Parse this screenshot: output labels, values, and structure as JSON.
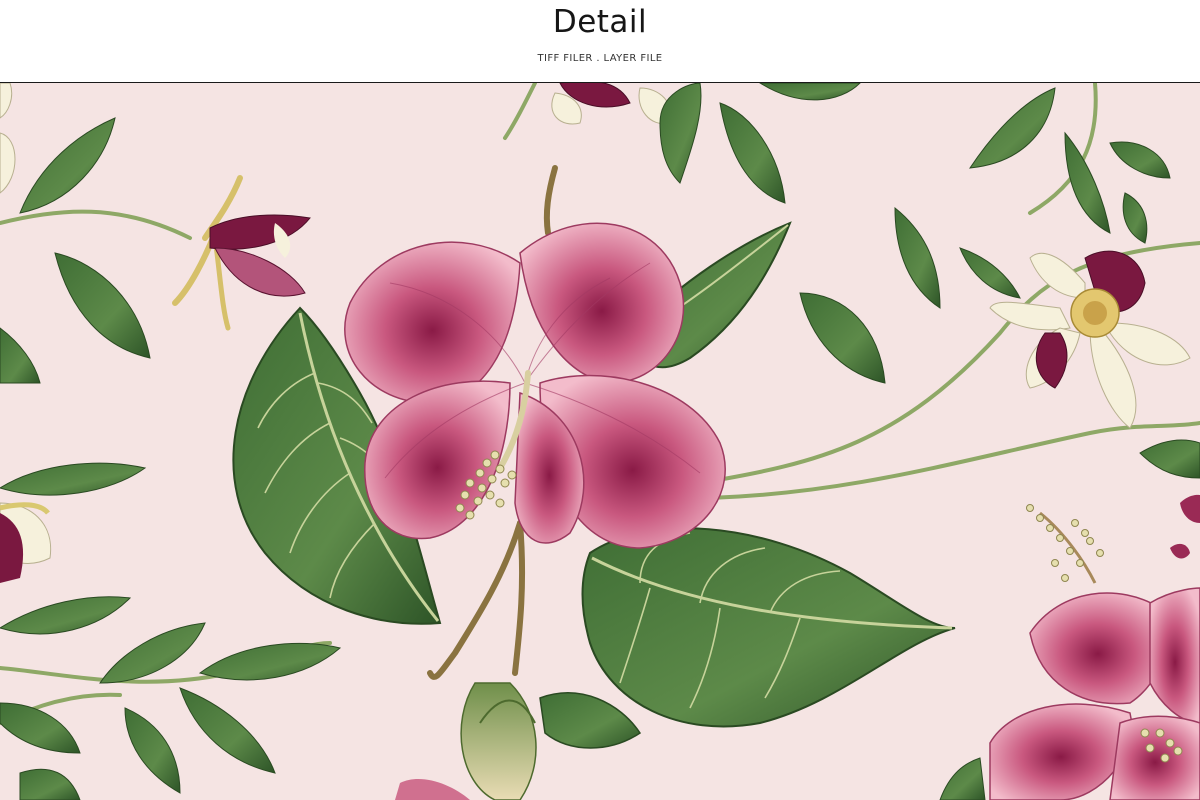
{
  "header": {
    "title": "Detail",
    "subtitle": "TIFF FILER . LAYER FILE"
  },
  "artwork": {
    "background_color": "#f5e4e3",
    "leaf_color": "#4a7a3c",
    "leaf_dark_color": "#2f5a2a",
    "petal_pink_color": "#e08aa6",
    "petal_deep_color": "#7a1840",
    "petal_cream_color": "#f6f1dc"
  }
}
